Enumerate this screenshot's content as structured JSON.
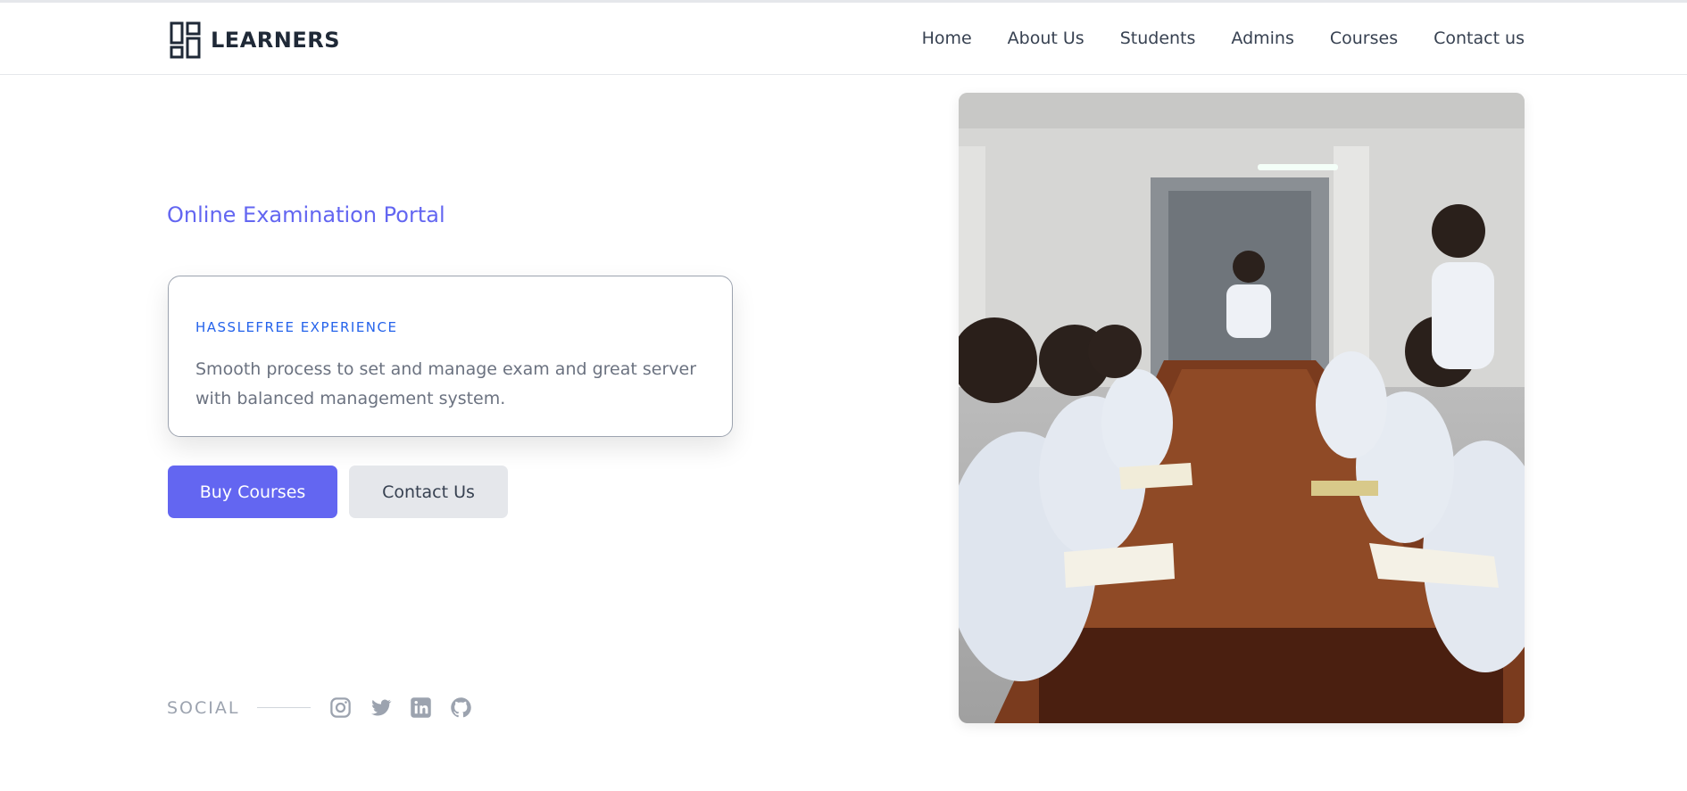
{
  "brand": {
    "name": "LEARNERS"
  },
  "nav": {
    "items": [
      "Home",
      "About Us",
      "Students",
      "Admins",
      "Courses",
      "Contact us"
    ]
  },
  "hero": {
    "subtitle": "Online Examination Portal",
    "card": {
      "kicker": "HASSLEFREE EXPERIENCE",
      "text": "Smooth process to set and manage exam and great server with balanced management system."
    },
    "buttons": {
      "primary": "Buy Courses",
      "secondary": "Contact Us"
    }
  },
  "social": {
    "label": "SOCIAL",
    "icons": [
      "instagram-icon",
      "twitter-icon",
      "linkedin-icon",
      "github-icon"
    ]
  },
  "colors": {
    "accent": "#6366f1",
    "kicker": "#2563eb",
    "muted": "#6b7280"
  }
}
